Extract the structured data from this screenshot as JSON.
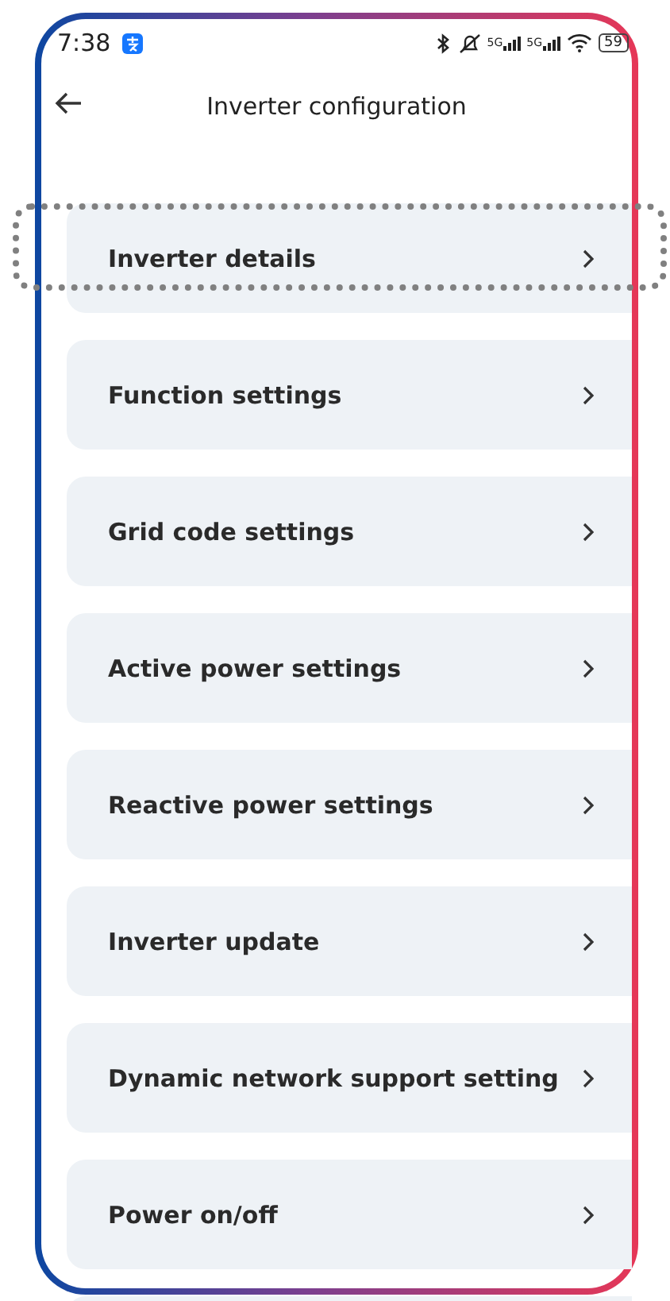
{
  "status_bar": {
    "time": "7:38",
    "signals": [
      "5G",
      "5G"
    ],
    "battery": "59"
  },
  "header": {
    "title": "Inverter configuration"
  },
  "items": [
    {
      "label": "Inverter details",
      "highlighted": true
    },
    {
      "label": "Function settings",
      "highlighted": false
    },
    {
      "label": "Grid code settings",
      "highlighted": false
    },
    {
      "label": "Active power settings",
      "highlighted": false
    },
    {
      "label": "Reactive power settings",
      "highlighted": false
    },
    {
      "label": "Inverter update",
      "highlighted": false
    },
    {
      "label": "Dynamic network support setting",
      "highlighted": false
    },
    {
      "label": "Power on/off",
      "highlighted": false
    }
  ]
}
